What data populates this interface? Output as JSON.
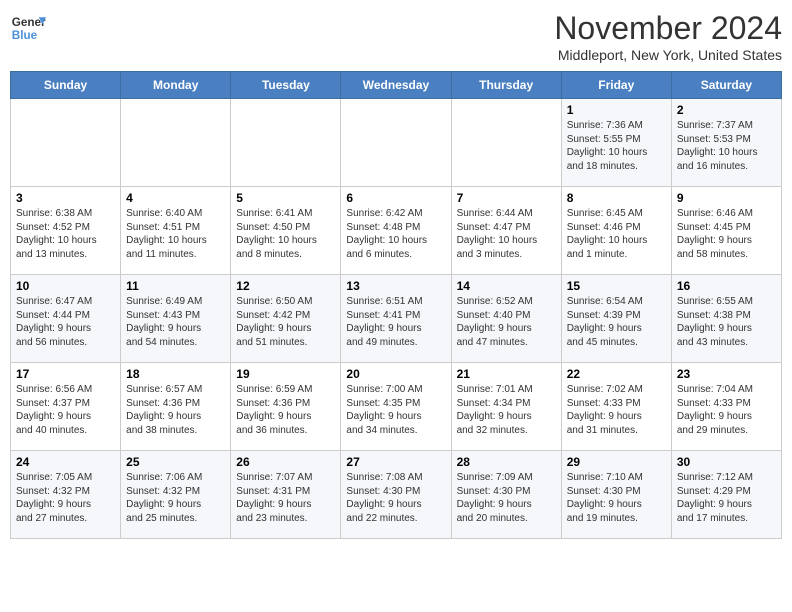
{
  "header": {
    "logo_line1": "General",
    "logo_line2": "Blue",
    "month_title": "November 2024",
    "location": "Middleport, New York, United States"
  },
  "weekdays": [
    "Sunday",
    "Monday",
    "Tuesday",
    "Wednesday",
    "Thursday",
    "Friday",
    "Saturday"
  ],
  "weeks": [
    [
      {
        "day": "",
        "info": ""
      },
      {
        "day": "",
        "info": ""
      },
      {
        "day": "",
        "info": ""
      },
      {
        "day": "",
        "info": ""
      },
      {
        "day": "",
        "info": ""
      },
      {
        "day": "1",
        "info": "Sunrise: 7:36 AM\nSunset: 5:55 PM\nDaylight: 10 hours\nand 18 minutes."
      },
      {
        "day": "2",
        "info": "Sunrise: 7:37 AM\nSunset: 5:53 PM\nDaylight: 10 hours\nand 16 minutes."
      }
    ],
    [
      {
        "day": "3",
        "info": "Sunrise: 6:38 AM\nSunset: 4:52 PM\nDaylight: 10 hours\nand 13 minutes."
      },
      {
        "day": "4",
        "info": "Sunrise: 6:40 AM\nSunset: 4:51 PM\nDaylight: 10 hours\nand 11 minutes."
      },
      {
        "day": "5",
        "info": "Sunrise: 6:41 AM\nSunset: 4:50 PM\nDaylight: 10 hours\nand 8 minutes."
      },
      {
        "day": "6",
        "info": "Sunrise: 6:42 AM\nSunset: 4:48 PM\nDaylight: 10 hours\nand 6 minutes."
      },
      {
        "day": "7",
        "info": "Sunrise: 6:44 AM\nSunset: 4:47 PM\nDaylight: 10 hours\nand 3 minutes."
      },
      {
        "day": "8",
        "info": "Sunrise: 6:45 AM\nSunset: 4:46 PM\nDaylight: 10 hours\nand 1 minute."
      },
      {
        "day": "9",
        "info": "Sunrise: 6:46 AM\nSunset: 4:45 PM\nDaylight: 9 hours\nand 58 minutes."
      }
    ],
    [
      {
        "day": "10",
        "info": "Sunrise: 6:47 AM\nSunset: 4:44 PM\nDaylight: 9 hours\nand 56 minutes."
      },
      {
        "day": "11",
        "info": "Sunrise: 6:49 AM\nSunset: 4:43 PM\nDaylight: 9 hours\nand 54 minutes."
      },
      {
        "day": "12",
        "info": "Sunrise: 6:50 AM\nSunset: 4:42 PM\nDaylight: 9 hours\nand 51 minutes."
      },
      {
        "day": "13",
        "info": "Sunrise: 6:51 AM\nSunset: 4:41 PM\nDaylight: 9 hours\nand 49 minutes."
      },
      {
        "day": "14",
        "info": "Sunrise: 6:52 AM\nSunset: 4:40 PM\nDaylight: 9 hours\nand 47 minutes."
      },
      {
        "day": "15",
        "info": "Sunrise: 6:54 AM\nSunset: 4:39 PM\nDaylight: 9 hours\nand 45 minutes."
      },
      {
        "day": "16",
        "info": "Sunrise: 6:55 AM\nSunset: 4:38 PM\nDaylight: 9 hours\nand 43 minutes."
      }
    ],
    [
      {
        "day": "17",
        "info": "Sunrise: 6:56 AM\nSunset: 4:37 PM\nDaylight: 9 hours\nand 40 minutes."
      },
      {
        "day": "18",
        "info": "Sunrise: 6:57 AM\nSunset: 4:36 PM\nDaylight: 9 hours\nand 38 minutes."
      },
      {
        "day": "19",
        "info": "Sunrise: 6:59 AM\nSunset: 4:36 PM\nDaylight: 9 hours\nand 36 minutes."
      },
      {
        "day": "20",
        "info": "Sunrise: 7:00 AM\nSunset: 4:35 PM\nDaylight: 9 hours\nand 34 minutes."
      },
      {
        "day": "21",
        "info": "Sunrise: 7:01 AM\nSunset: 4:34 PM\nDaylight: 9 hours\nand 32 minutes."
      },
      {
        "day": "22",
        "info": "Sunrise: 7:02 AM\nSunset: 4:33 PM\nDaylight: 9 hours\nand 31 minutes."
      },
      {
        "day": "23",
        "info": "Sunrise: 7:04 AM\nSunset: 4:33 PM\nDaylight: 9 hours\nand 29 minutes."
      }
    ],
    [
      {
        "day": "24",
        "info": "Sunrise: 7:05 AM\nSunset: 4:32 PM\nDaylight: 9 hours\nand 27 minutes."
      },
      {
        "day": "25",
        "info": "Sunrise: 7:06 AM\nSunset: 4:32 PM\nDaylight: 9 hours\nand 25 minutes."
      },
      {
        "day": "26",
        "info": "Sunrise: 7:07 AM\nSunset: 4:31 PM\nDaylight: 9 hours\nand 23 minutes."
      },
      {
        "day": "27",
        "info": "Sunrise: 7:08 AM\nSunset: 4:30 PM\nDaylight: 9 hours\nand 22 minutes."
      },
      {
        "day": "28",
        "info": "Sunrise: 7:09 AM\nSunset: 4:30 PM\nDaylight: 9 hours\nand 20 minutes."
      },
      {
        "day": "29",
        "info": "Sunrise: 7:10 AM\nSunset: 4:30 PM\nDaylight: 9 hours\nand 19 minutes."
      },
      {
        "day": "30",
        "info": "Sunrise: 7:12 AM\nSunset: 4:29 PM\nDaylight: 9 hours\nand 17 minutes."
      }
    ]
  ]
}
